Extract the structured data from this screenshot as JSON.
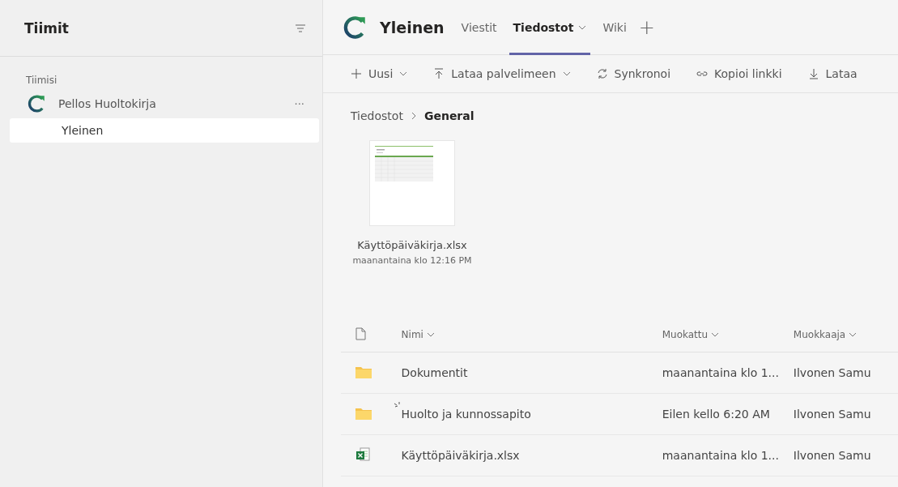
{
  "sidebar": {
    "title": "Tiimit",
    "section": "Tiimisi",
    "teams": [
      {
        "name": "Pellos Huoltokirja",
        "more": "···",
        "channels": [
          {
            "name": "Yleinen",
            "selected": true
          }
        ]
      }
    ]
  },
  "channel": {
    "name": "Yleinen",
    "tabs": [
      {
        "label": "Viestit",
        "selected": false,
        "dropdown": false
      },
      {
        "label": "Tiedostot",
        "selected": true,
        "dropdown": true
      },
      {
        "label": "Wiki",
        "selected": false,
        "dropdown": false
      }
    ],
    "add": "+"
  },
  "toolbar": [
    {
      "kind": "new",
      "label": "Uusi",
      "dropdown": true
    },
    {
      "kind": "upload",
      "label": "Lataa palvelimeen",
      "dropdown": true
    },
    {
      "kind": "sync",
      "label": "Synkronoi",
      "dropdown": false
    },
    {
      "kind": "link",
      "label": "Kopioi linkki",
      "dropdown": false
    },
    {
      "kind": "download",
      "label": "Lataa",
      "dropdown": false
    }
  ],
  "breadcrumb": [
    {
      "label": "Tiedostot",
      "current": false
    },
    {
      "label": "General",
      "current": true
    }
  ],
  "tiles": [
    {
      "name": "Käyttöpäiväkirja.xlsx",
      "date": "maanantaina klo 12:16 PM"
    }
  ],
  "table": {
    "columns": [
      "Nimi",
      "Muokattu",
      "Muokkaaja"
    ],
    "rows": [
      {
        "kind": "folder",
        "name": "Dokumentit",
        "modified": "maanantaina klo 1...",
        "editor": "Ilvonen Samu",
        "new": false
      },
      {
        "kind": "folder",
        "name": "Huolto ja kunnossapito",
        "modified": "Eilen kello 6:20 AM",
        "editor": "Ilvonen Samu",
        "new": true
      },
      {
        "kind": "excel",
        "name": "Käyttöpäiväkirja.xlsx",
        "modified": "maanantaina klo 1...",
        "editor": "Ilvonen Samu",
        "new": false
      }
    ]
  }
}
